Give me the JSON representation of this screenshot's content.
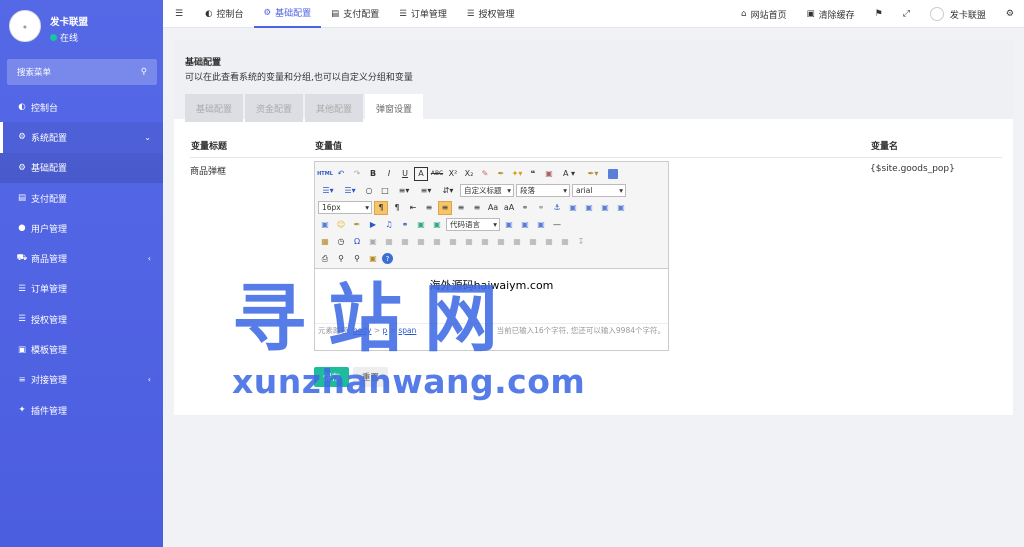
{
  "sidebar": {
    "user_name": "发卡联盟",
    "status": "在线",
    "search_placeholder": "搜索菜单",
    "items": [
      {
        "label": "控制台",
        "icon": "dashboard-icon"
      },
      {
        "label": "系统配置",
        "icon": "gear-icon"
      },
      {
        "label": "基础配置",
        "icon": "gear-icon"
      },
      {
        "label": "支付配置",
        "icon": "card-icon"
      },
      {
        "label": "用户管理",
        "icon": "user-icon"
      },
      {
        "label": "商品管理",
        "icon": "cart-icon"
      },
      {
        "label": "订单管理",
        "icon": "list-icon"
      },
      {
        "label": "授权管理",
        "icon": "list-icon"
      },
      {
        "label": "模板管理",
        "icon": "template-icon"
      },
      {
        "label": "对接管理",
        "icon": "sliders-icon"
      },
      {
        "label": "插件管理",
        "icon": "plug-icon"
      }
    ]
  },
  "topbar": {
    "tabs": [
      {
        "label": "控制台"
      },
      {
        "label": "基础配置"
      },
      {
        "label": "支付配置"
      },
      {
        "label": "订单管理"
      },
      {
        "label": "授权管理"
      }
    ],
    "home": "网站首页",
    "clear_cache": "清除缓存",
    "user": "发卡联盟"
  },
  "content": {
    "title": "基础配置",
    "description": "可以在此查看系统的变量和分组,也可以自定义分组和变量",
    "tabs": [
      "基础配置",
      "资金配置",
      "其他配置",
      "弹窗设置"
    ],
    "table": {
      "headers": [
        "变量标题",
        "变量值",
        "变量名"
      ],
      "row": {
        "title": "商品弹框",
        "name": "{$site.goods_pop}"
      }
    }
  },
  "editor": {
    "heading_select": "自定义标题",
    "paragraph_select": "段落",
    "font_select": "arial",
    "size_select": "16px",
    "code_select": "代码语言",
    "text": "海外源码haiwaiym.com",
    "path_label": "元素路径:",
    "path_items": [
      "body",
      "p",
      "span"
    ],
    "count_text": "当前已输入16个字符, 您还可以输入9984个字符。"
  },
  "buttons": {
    "save": "保存",
    "reset": "重置"
  },
  "watermark": {
    "big": "寻站网",
    "small": "xunzhanwang.com"
  },
  "colors": {
    "sidebar": "#4f62e4",
    "accent": "#4e63e3",
    "save": "#1fbc9c",
    "online": "#18c5a4"
  }
}
